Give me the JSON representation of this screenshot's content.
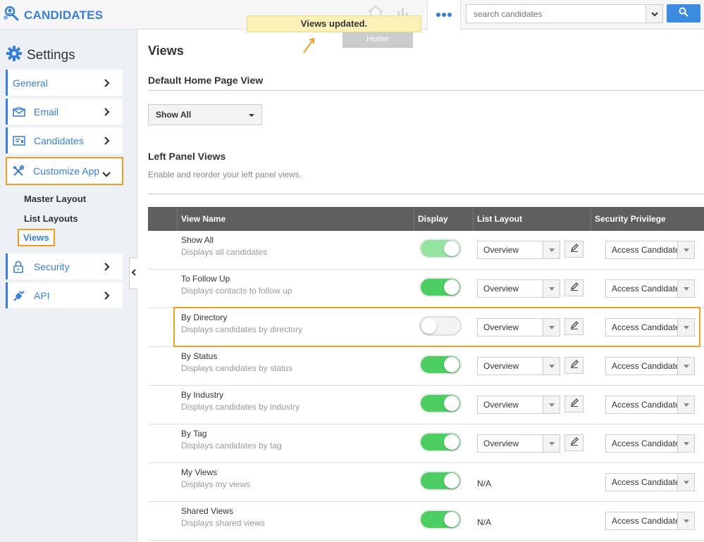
{
  "brand": {
    "name": "CANDIDATES"
  },
  "toast": {
    "message": "Views updated.",
    "tooltip": "Home"
  },
  "search": {
    "placeholder": "search candidates"
  },
  "sidebar": {
    "title": "Settings",
    "items": [
      {
        "label": "General"
      },
      {
        "label": "Email"
      },
      {
        "label": "Candidates"
      },
      {
        "label": "Customize App"
      },
      {
        "label": "Security"
      },
      {
        "label": "API"
      }
    ],
    "subitems": [
      {
        "label": "Master Layout"
      },
      {
        "label": "List Layouts"
      },
      {
        "label": "Views"
      }
    ]
  },
  "main": {
    "title": "Views",
    "default_heading": "Default Home Page View",
    "default_value": "Show All",
    "left_heading": "Left Panel Views",
    "left_subtitle": "Enable and reorder your left panel views."
  },
  "table": {
    "headers": {
      "view_name": "View Name",
      "display": "Display",
      "list_layout": "List Layout",
      "security": "Security Privilege"
    },
    "rows": [
      {
        "name": "Show All",
        "desc": "Displays all candidates",
        "display": "on-disabled",
        "layout": "Overview",
        "security": "Access Candidates"
      },
      {
        "name": "To Follow Up",
        "desc": "Displays contacts to follow up",
        "display": "on",
        "layout": "Overview",
        "security": "Access Candidates"
      },
      {
        "name": "By Directory",
        "desc": "Displays candidates by directory",
        "display": "off",
        "layout": "Overview",
        "security": "Access Candidates"
      },
      {
        "name": "By Status",
        "desc": "Displays candidates by status",
        "display": "on",
        "layout": "Overview",
        "security": "Access Candidates"
      },
      {
        "name": "By Industry",
        "desc": "Displays candidates by industry",
        "display": "on",
        "layout": "Overview",
        "security": "Access Candidates"
      },
      {
        "name": "By Tag",
        "desc": "Displays candidates by tag",
        "display": "on",
        "layout": "Overview",
        "security": "Access Candidates"
      },
      {
        "name": "My Views",
        "desc": "Displays my views",
        "display": "on",
        "layout": "N/A",
        "security": "Access Candidates"
      },
      {
        "name": "Shared Views",
        "desc": "Displays shared views",
        "display": "on",
        "layout": "N/A",
        "security": "Access Candidates"
      }
    ]
  },
  "colors": {
    "accent": "#3a7fd5",
    "highlight": "#f39c26",
    "toggle_on": "#4cce62"
  }
}
